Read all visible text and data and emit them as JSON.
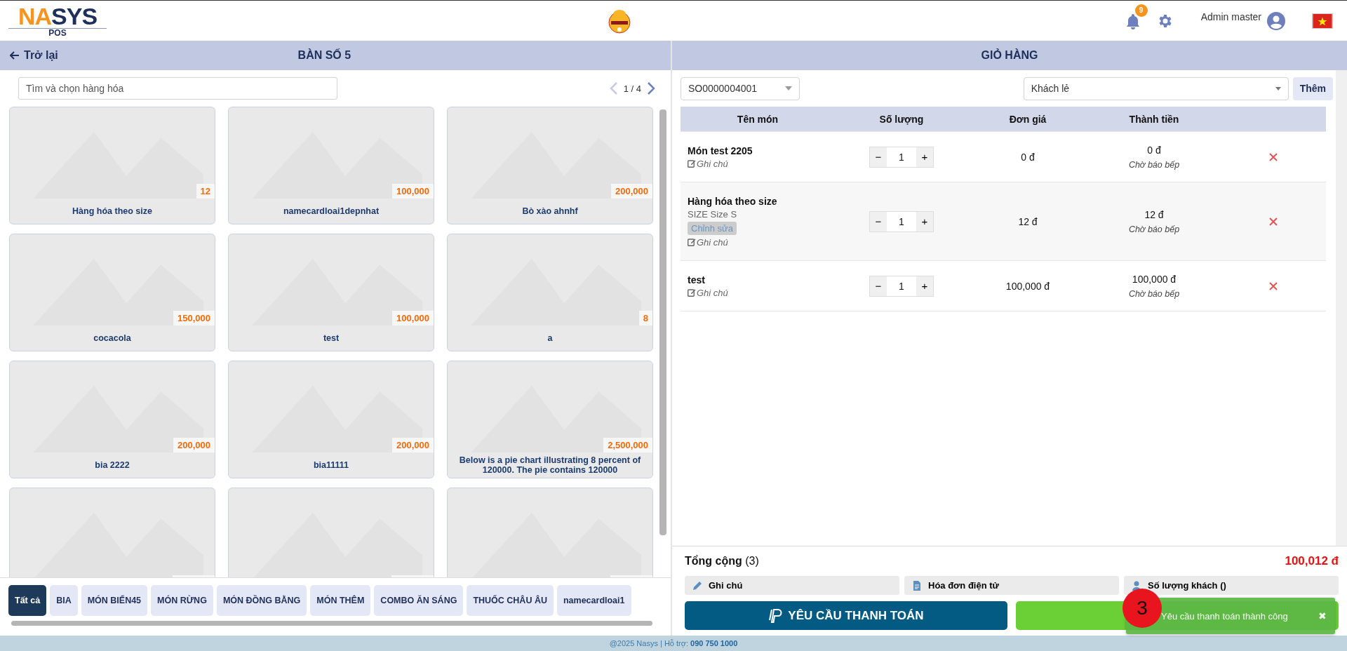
{
  "header": {
    "logo_parts": [
      {
        "text": "NA",
        "color": "#f7941d"
      },
      {
        "text": "S",
        "color": "#1e2f5a"
      },
      {
        "text": "YS",
        "color": "#1e2f5a"
      }
    ],
    "logo_subtext": "POS",
    "notification_count": "9",
    "user_name": "Admin master"
  },
  "left_panel": {
    "back_label": "Trở lại",
    "title": "BÀN SỐ 5",
    "search": {
      "placeholder": "Tìm và chọn hàng hóa"
    },
    "page_indicator": "1 / 4",
    "products": [
      {
        "kind": "full",
        "name": "Hàng hóa theo size",
        "price": "12"
      },
      {
        "kind": "full",
        "name": "namecardloai1depnhat",
        "price": "100,000"
      },
      {
        "kind": "full",
        "name": "Bò xào ahnhf",
        "price": "200,000"
      },
      {
        "kind": "full",
        "name": "cocacola",
        "price": "150,000"
      },
      {
        "kind": "full",
        "name": "test",
        "price": "100,000"
      },
      {
        "kind": "full",
        "name": "a",
        "price": "8"
      },
      {
        "kind": "full",
        "name": "bia 2222",
        "price": "200,000"
      },
      {
        "kind": "full",
        "name": "bia11111",
        "price": "200,000"
      },
      {
        "kind": "full",
        "name": "Below is a pie chart illustrating 8 percent of 120000. The pie contains 120000",
        "price": "2,500,000"
      },
      {
        "kind": "cut_off"
      },
      {
        "kind": "cut_off"
      },
      {
        "kind": "cut_off"
      }
    ],
    "categories": [
      {
        "label": "Tất cả",
        "selected": true
      },
      {
        "label": "BIA",
        "selected": false
      },
      {
        "label": "MÓN BIỂN45",
        "selected": false
      },
      {
        "label": "MÓN RỪNG",
        "selected": false
      },
      {
        "label": "MÓN ĐỒNG BẰNG",
        "selected": false
      },
      {
        "label": "MÓN THÊM",
        "selected": false
      },
      {
        "label": "COMBO ĂN SÁNG",
        "selected": false
      },
      {
        "label": "THUỐC CHÂU ÂU",
        "selected": false
      },
      {
        "label": "namecardloai1",
        "selected": false
      }
    ]
  },
  "cart": {
    "title": "GIỎ HÀNG",
    "order_select": "SO0000004001",
    "customer_select": "Khách lẻ",
    "add_button": "Thêm",
    "columns": [
      "Tên món",
      "Số lượng",
      "Đơn giá",
      "Thành tiền"
    ],
    "rows": [
      {
        "name": "Món test 2205",
        "note_label": "Ghi chú",
        "quantity": "1",
        "minus": "−",
        "plus": "+",
        "unit_price": "0 đ",
        "total": "0 đ",
        "status": "Chờ báo bếp"
      },
      {
        "name": "Hàng hóa theo size",
        "variant": "SIZE Size S",
        "edit_label": "Chỉnh sửa",
        "note_label": "Ghi chú",
        "quantity": "1",
        "minus": "−",
        "plus": "+",
        "unit_price": "12 đ",
        "total": "12 đ",
        "status": "Chờ báo bếp"
      },
      {
        "name": "test",
        "note_label": "Ghi chú",
        "quantity": "1",
        "minus": "−",
        "plus": "+",
        "unit_price": "100,000 đ",
        "total": "100,000 đ",
        "status": "Chờ báo bếp"
      }
    ],
    "total_label": "Tổng cộng",
    "total_count": "(3)",
    "total_value": "100,012 đ",
    "options": [
      {
        "kind": "note",
        "label": "Ghi chú"
      },
      {
        "kind": "invoice",
        "label": "Hóa đơn điện tử"
      },
      {
        "kind": "guests",
        "label": "Số lượng khách ()"
      }
    ],
    "pay_button": "YÊU CẦU THANH TOÁN"
  },
  "footer": {
    "text": "@2025 Nasys | Hỗ trợ: **090 750 1000**"
  },
  "toast": {
    "message": "Yêu cầu thanh toán thành công",
    "close": "✖"
  },
  "step_marker": "3"
}
